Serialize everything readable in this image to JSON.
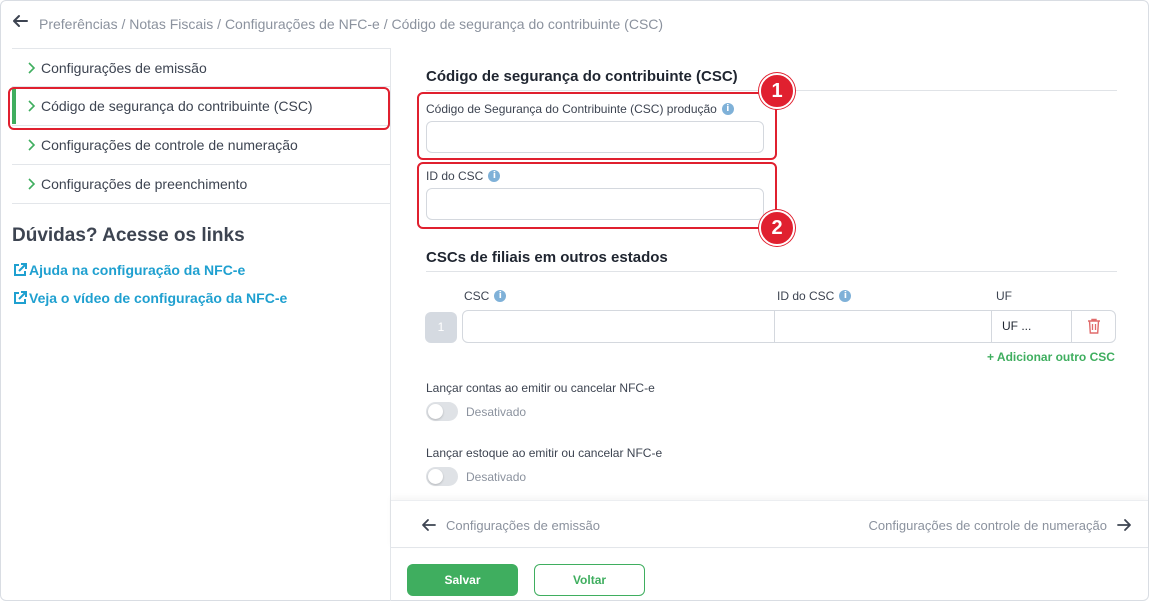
{
  "header": {
    "breadcrumb": "Preferências / Notas Fiscais / Configurações de NFC-e / Código de segurança do contribuinte (CSC)"
  },
  "sidebar": {
    "items": [
      {
        "label": "Configurações de emissão"
      },
      {
        "label": "Código de segurança do contribuinte (CSC)",
        "active": true
      },
      {
        "label": "Configurações de controle de numeração"
      },
      {
        "label": "Configurações de preenchimento"
      }
    ],
    "help_title": "Dúvidas? Acesse os links",
    "links": [
      {
        "label": "Ajuda na configuração da NFC-e"
      },
      {
        "label": "Veja o vídeo de configuração da NFC-e"
      }
    ]
  },
  "main": {
    "csc_section_title": "Código de segurança do contribuinte (CSC)",
    "csc_prod_label": "Código de Segurança do Contribuinte (CSC) produção",
    "csc_prod_value": "",
    "csc_id_label": "ID do CSC",
    "csc_id_value": "",
    "filiais_title": "CSCs de filiais em outros estados",
    "columns": {
      "csc": "CSC",
      "id": "ID do CSC",
      "uf": "UF"
    },
    "rows": [
      {
        "number": "1",
        "csc": "",
        "id": "",
        "uf": "UF ..."
      }
    ],
    "add_label": "+ Adicionar outro CSC",
    "toggles": [
      {
        "label": "Lançar contas ao emitir ou cancelar NFC-e",
        "state": "Desativado",
        "on": false
      },
      {
        "label": "Lançar estoque ao emitir ou cancelar NFC-e",
        "state": "Desativado",
        "on": false
      }
    ]
  },
  "annotations": {
    "badge1": "1",
    "badge2": "2"
  },
  "footer": {
    "prev_label": "Configurações de emissão",
    "next_label": "Configurações de controle de numeração",
    "save_label": "Salvar",
    "back_label": "Voltar"
  },
  "colors": {
    "accent": "#3fae5f",
    "link": "#1fa0d0",
    "highlight": "#e0202f"
  },
  "icons": [
    "back-arrow-icon",
    "chevron-right-icon",
    "external-link-icon",
    "info-icon",
    "trash-icon",
    "arrow-left-icon",
    "arrow-right-icon"
  ]
}
